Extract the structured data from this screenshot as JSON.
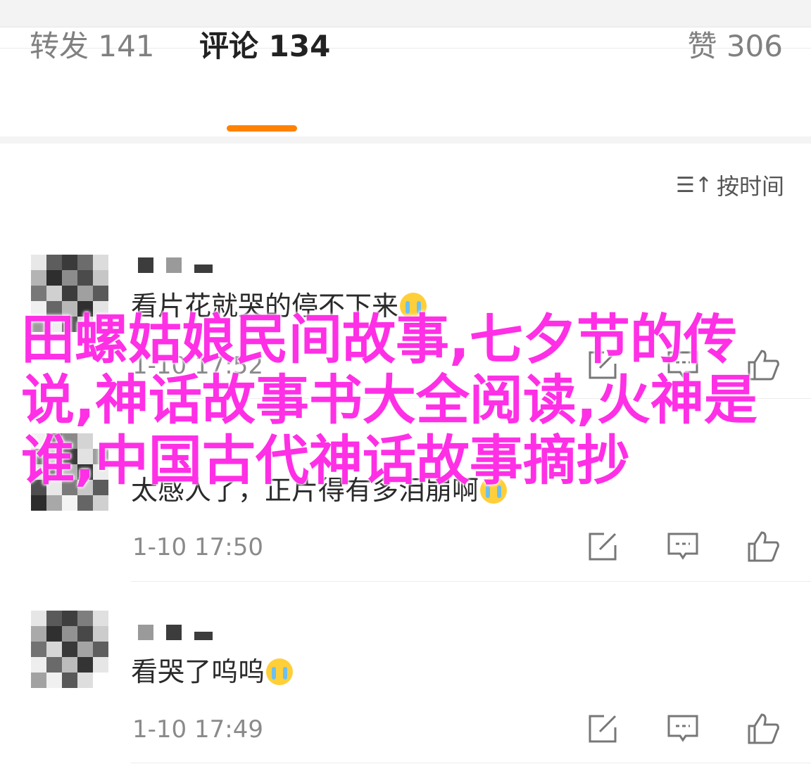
{
  "tabs": {
    "repost_label": "转发 141",
    "comments_label": "评论 134",
    "likes_label": "赞 306",
    "active_color": "#ff8200"
  },
  "sort": {
    "icon": "sort-icon",
    "label": "按时间"
  },
  "comments": [
    {
      "text": "看片花就哭的停不下来",
      "emoji": "crying-face-emoji",
      "timestamp": "1-10 17:52"
    },
    {
      "text": "太感人了，正片得有多泪崩啊",
      "emoji": "crying-face-emoji",
      "timestamp": "1-10 17:50"
    },
    {
      "text": "看哭了呜呜",
      "emoji": "crying-face-emoji",
      "timestamp": "1-10 17:49"
    }
  ],
  "overlay": {
    "title": "田螺姑娘民间故事,七夕节的传说,神话故事书大全阅读,火神是谁,中国古代神话故事摘抄",
    "color": "#ff2fe6"
  },
  "action_icons": [
    "share-icon",
    "comment-icon",
    "like-icon"
  ]
}
